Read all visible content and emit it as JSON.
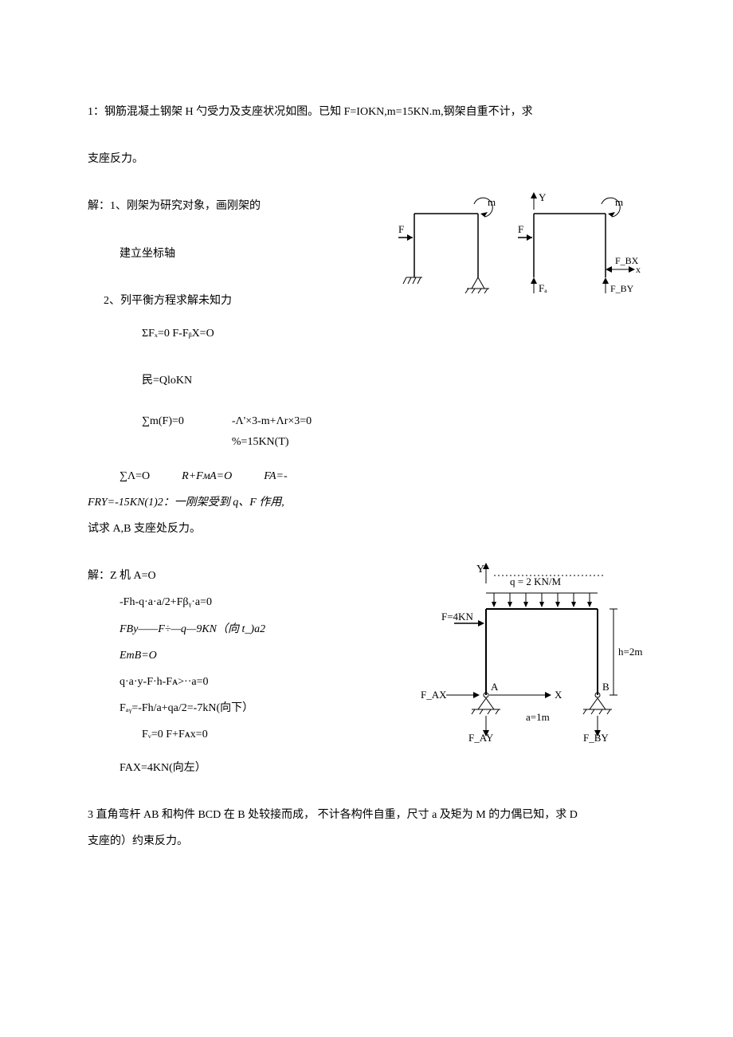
{
  "p1": {
    "line1": "1：钢筋混凝土钢架 H 勺受力及支座状况如图。已知 F=IOKN,m=15KN.m,钢架自重不计，求",
    "line2": "支座反力。",
    "sol_h1": "解：1、刚架为研究对象，画刚架的",
    "sol_h2": "建立坐标轴",
    "sol_h3": "2、列平衡方程求解未知力",
    "eq1": "ΣFₓ=0 F-FᵦX=O",
    "eq2": "民=QloKN",
    "eq3a": "∑m(F)=0",
    "eq3b": "-Λ'×3-m+Λr×3=0",
    "eq3c": "%=15KN(T)",
    "eq4a": "∑Λ=O",
    "eq4b": "R+FᴍA=O",
    "eq4c": "FA=-",
    "eq4d": "FRY=-15KN(1)2：一刚架受到 q、F 作用,",
    "eq4e": "试求 A,B 支座处反力。",
    "fig1": {
      "m": "m",
      "F": "F",
      "Y": "Y",
      "FA": "Fₐ",
      "FBX": "F_BX",
      "FBY": "F_BY",
      "x": "x"
    }
  },
  "p2": {
    "sol_h": "解：Z 机 A=O",
    "eq1": "-Fh-q·a·a/2+Fβᵧ·a=0",
    "eq2": "FBy——F÷—q—9KN（向 t_)a2",
    "eq3": "EmB=O",
    "eq4": "q·a·y-F·h-Fᴀ>··a=0",
    "eq5": "Fₐᵧ=-Fh/a+qa/2=-7kN(向下）",
    "eq6": "Fᵥ=0 F+Fᴀx=0",
    "eq7": "FAX=4KN(向左）",
    "fig2": {
      "Y": "Y",
      "q": "q = 2 KN/M",
      "F": "F=4KN",
      "h": "h=2m",
      "A": "A",
      "B": "B",
      "X": "X",
      "a": "a=1m",
      "FAX": "F_AX",
      "FAY": "F_AY",
      "FBY": "F_BY"
    }
  },
  "p3": {
    "line1": "3 直角弯杆 AB 和构件 BCD 在 B 处较接而成， 不计各构件自重，尺寸 a 及矩为 M 的力偶已知，求 D",
    "line2": "支座的）约束反力。"
  }
}
